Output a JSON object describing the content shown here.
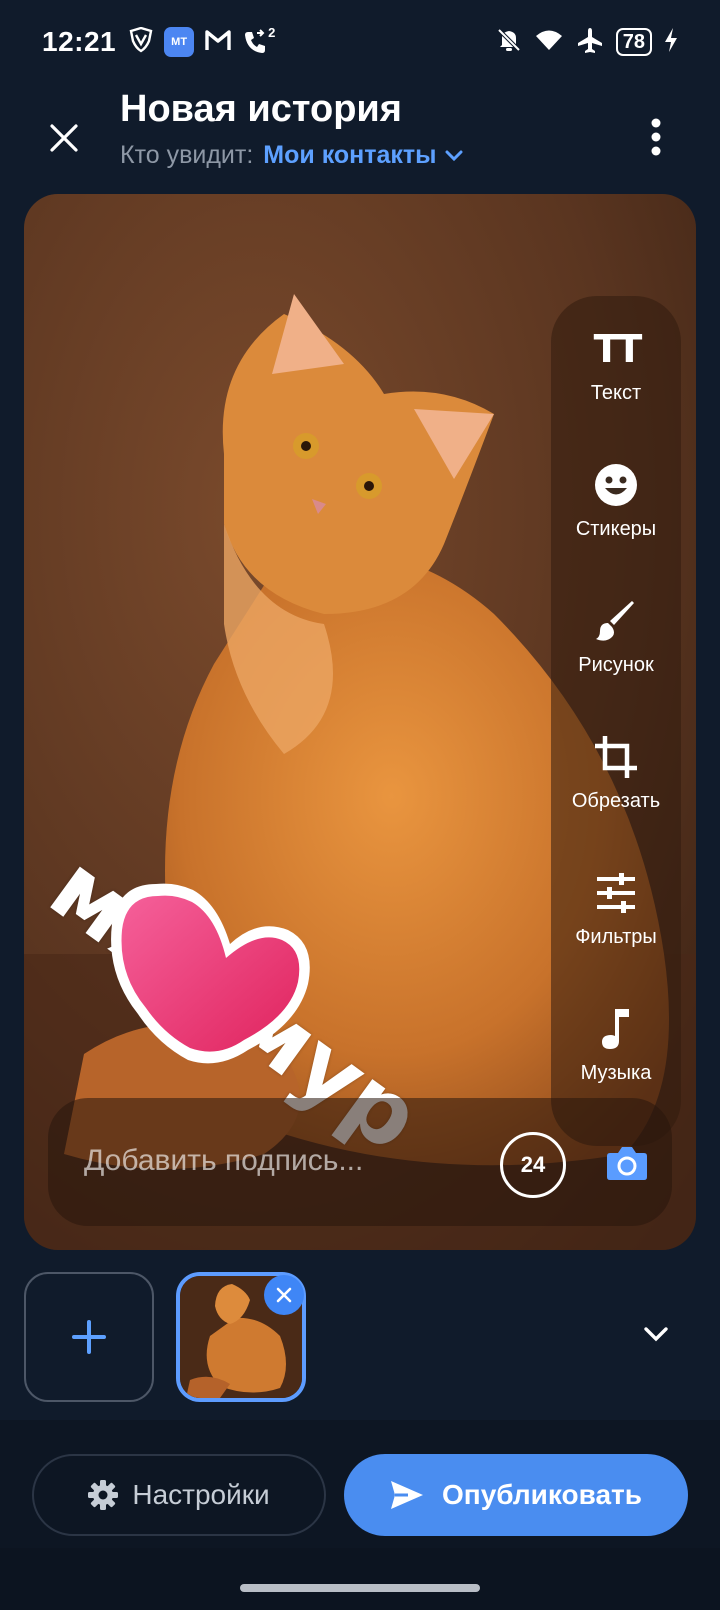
{
  "status_bar": {
    "time": "12:21",
    "mini_app_text": "МТ",
    "signal_badge": "2",
    "battery": "78",
    "icons": [
      "shield-icon",
      "app-icon",
      "gmail-icon",
      "call-forward-icon",
      "bell-off-icon",
      "wifi-icon",
      "airplane-icon",
      "battery-icon",
      "charging-icon"
    ]
  },
  "header": {
    "title": "Новая история",
    "audience_prefix": "Кто увидит:",
    "audience_value": "Мои контакты"
  },
  "editor": {
    "overlay_text": "мяу мур",
    "sticker": "heart-sticker",
    "tools": [
      {
        "label": "Текст",
        "icon": "text-icon"
      },
      {
        "label": "Стикеры",
        "icon": "sticker-icon"
      },
      {
        "label": "Рисунок",
        "icon": "brush-icon"
      },
      {
        "label": "Обрезать",
        "icon": "crop-icon"
      },
      {
        "label": "Фильтры",
        "icon": "filters-icon"
      },
      {
        "label": "Музыка",
        "icon": "music-icon"
      }
    ],
    "text_icon_glyph": "TT",
    "caption_placeholder": "Добавить подпись...",
    "caption_counter": "24"
  },
  "bottom": {
    "settings_label": "Настройки",
    "publish_label": "Опубликовать"
  },
  "colors": {
    "background": "#101b2b",
    "accent": "#4a8df0",
    "link": "#5da0ff"
  }
}
